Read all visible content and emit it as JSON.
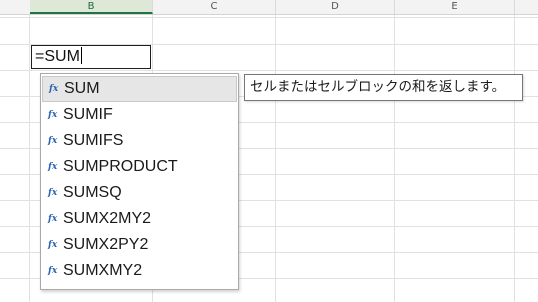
{
  "columns": [
    {
      "label": "B",
      "selected": true
    },
    {
      "label": "C",
      "selected": false
    },
    {
      "label": "D",
      "selected": false
    },
    {
      "label": "E",
      "selected": false
    }
  ],
  "active_cell": {
    "value": "=SUM"
  },
  "autocomplete": {
    "icon": "function-icon",
    "items": [
      {
        "label": "SUM",
        "selected": true
      },
      {
        "label": "SUMIF",
        "selected": false
      },
      {
        "label": "SUMIFS",
        "selected": false
      },
      {
        "label": "SUMPRODUCT",
        "selected": false
      },
      {
        "label": "SUMSQ",
        "selected": false
      },
      {
        "label": "SUMX2MY2",
        "selected": false
      },
      {
        "label": "SUMX2PY2",
        "selected": false
      },
      {
        "label": "SUMXMY2",
        "selected": false
      }
    ]
  },
  "tooltip": {
    "text": "セルまたはセルブロックの和を返します。"
  },
  "colors": {
    "accent": "#217346",
    "fx_icon": "#2d62b3",
    "selected_item_bg": "#e6e6e6"
  }
}
